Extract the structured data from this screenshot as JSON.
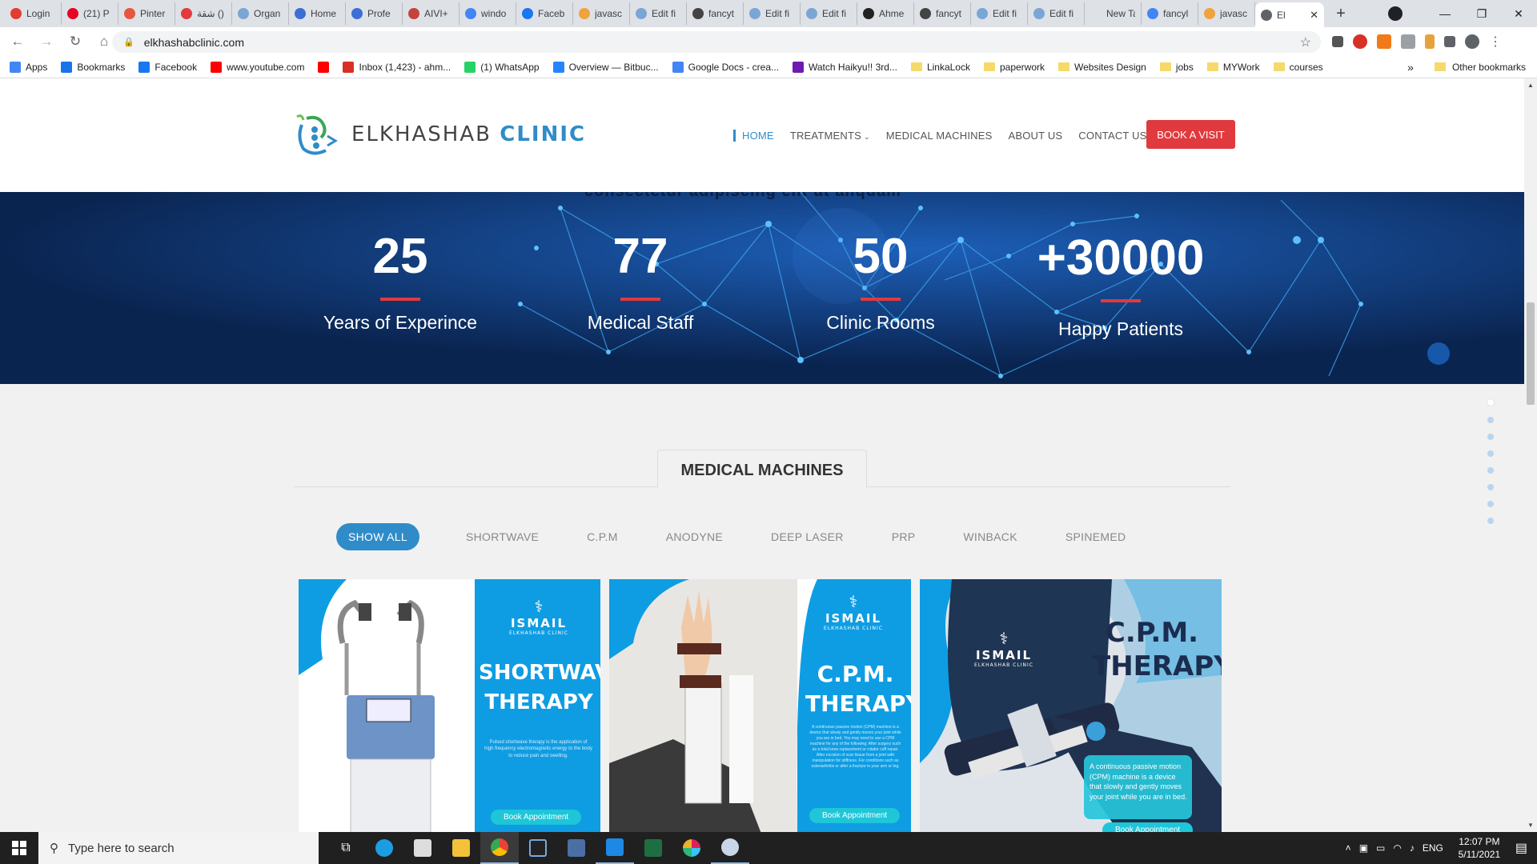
{
  "browser": {
    "tabs": [
      {
        "title": "Login",
        "color": "#e13c2d"
      },
      {
        "title": "(21) P",
        "color": "#e60023"
      },
      {
        "title": "Pinter",
        "color": "#e8553e"
      },
      {
        "title": "شقة ()",
        "color": "#e23b3b"
      },
      {
        "title": "Organ",
        "color": "#7aa6d6"
      },
      {
        "title": "Home",
        "color": "#3b6fd6"
      },
      {
        "title": "Profe",
        "color": "#3b6fd6"
      },
      {
        "title": "AIVI+",
        "color": "#c4433c"
      },
      {
        "title": "windo",
        "color": "#4285f4"
      },
      {
        "title": "Faceb",
        "color": "#1877f2"
      },
      {
        "title": "javasc",
        "color": "#f2a23b"
      },
      {
        "title": "Edit fi",
        "color": "#7aa6d6"
      },
      {
        "title": "fancyt",
        "color": "#444"
      },
      {
        "title": "Edit fi",
        "color": "#7aa6d6"
      },
      {
        "title": "Edit fi",
        "color": "#7aa6d6"
      },
      {
        "title": "Ahme",
        "color": "#222"
      },
      {
        "title": "fancyt",
        "color": "#444"
      },
      {
        "title": "Edit fi",
        "color": "#7aa6d6"
      },
      {
        "title": "Edit fi",
        "color": "#7aa6d6"
      },
      {
        "title": "New Tab",
        "color": "#dee1e6"
      },
      {
        "title": "fancyl",
        "color": "#4285f4"
      },
      {
        "title": "javasc",
        "color": "#f2a23b"
      }
    ],
    "active_tab": {
      "title": "El"
    },
    "new_tab": "+",
    "url": "elkhashabclinic.com",
    "bookmarks": [
      {
        "label": "Apps",
        "color": "#4285f4"
      },
      {
        "label": "Bookmarks",
        "color": "#1a73e8"
      },
      {
        "label": "Facebook",
        "color": "#1877f2"
      },
      {
        "label": "www.youtube.com",
        "color": "#ff0000"
      },
      {
        "label": "",
        "color": "#ff0000"
      },
      {
        "label": "Inbox (1,423) - ahm...",
        "color": "#d93025"
      },
      {
        "label": "(1) WhatsApp",
        "color": "#25d366"
      },
      {
        "label": "Overview — Bitbuc...",
        "color": "#2684ff"
      },
      {
        "label": "Google Docs - crea...",
        "color": "#4285f4"
      },
      {
        "label": "Watch Haikyu!! 3rd...",
        "color": "#6f1ab1"
      },
      {
        "label": "LinkaLock",
        "color": "folder"
      },
      {
        "label": "paperwork",
        "color": "folder"
      },
      {
        "label": "Websites Design",
        "color": "folder"
      },
      {
        "label": "jobs",
        "color": "folder"
      },
      {
        "label": "MYWork",
        "color": "folder"
      },
      {
        "label": "courses",
        "color": "folder"
      }
    ],
    "other_bookmarks": "Other bookmarks",
    "overflow": "»"
  },
  "site": {
    "logo_main": "ELKHASHAB",
    "logo_accent": "CLINIC",
    "nav": [
      {
        "label": "HOME",
        "active": true
      },
      {
        "label": "TREATMENTS",
        "caret": true
      },
      {
        "label": "MEDICAL MACHINES"
      },
      {
        "label": "ABOUT US"
      },
      {
        "label": "CONTACT US"
      }
    ],
    "cta": "BOOK A VISIT",
    "clipped_text": "consectetur adipiscing elit ut aliquam",
    "stats": [
      {
        "num": "25",
        "label": "Years of Experince"
      },
      {
        "num": "77",
        "label": "Medical Staff"
      },
      {
        "num": "50",
        "label": "Clinic Rooms"
      },
      {
        "num": "+30000",
        "label": "Happy Patients"
      }
    ],
    "section_title": "MEDICAL MACHINES",
    "filters": [
      "SHOW ALL",
      "SHORTWAVE",
      "C.P.M",
      "ANODYNE",
      "DEEP LASER",
      "PRP",
      "WINBACK",
      "SPINEMED"
    ],
    "cards": [
      {
        "brand": "ISMAIL",
        "brand_sub": "ELKHASHAB CLINIC",
        "title1": "SHORTWAVE",
        "title2": "THERAPY",
        "desc": "Pulsed shortwave therapy is the application of high frequency electromagnetic energy to the body to reduce pain and swelling.",
        "btn": "Book Appointment"
      },
      {
        "brand": "ISMAIL",
        "brand_sub": "ELKHASHAB CLINIC",
        "title1": "C.P.M.",
        "title2": "THERAPY",
        "desc": "A continuous passive motion (CPM) machine is a device that slowly and gently moves your joint while you are in bed. You may need to use a CPM machine for any of the following: After surgery such as a total knee replacement or rotator cuff repair. After excision of scar tissue from a joint with manipulation for stiffness. For conditions such as osteoarthritis or after a fracture in your arm or leg.",
        "btn": "Book Appointment"
      },
      {
        "brand": "ISMAIL",
        "brand_sub": "ELKHASHAB CLINIC",
        "title1": "C.P.M.",
        "title2": "THERAPY",
        "desc": "A continuous passive motion (CPM) machine is a device that slowly and gently moves your joint while you are in bed.",
        "btn": "Book Appointment"
      }
    ]
  },
  "taskbar": {
    "search_placeholder": "Type here to search",
    "lang": "ENG",
    "time": "12:07 PM",
    "date": "5/11/2021"
  }
}
